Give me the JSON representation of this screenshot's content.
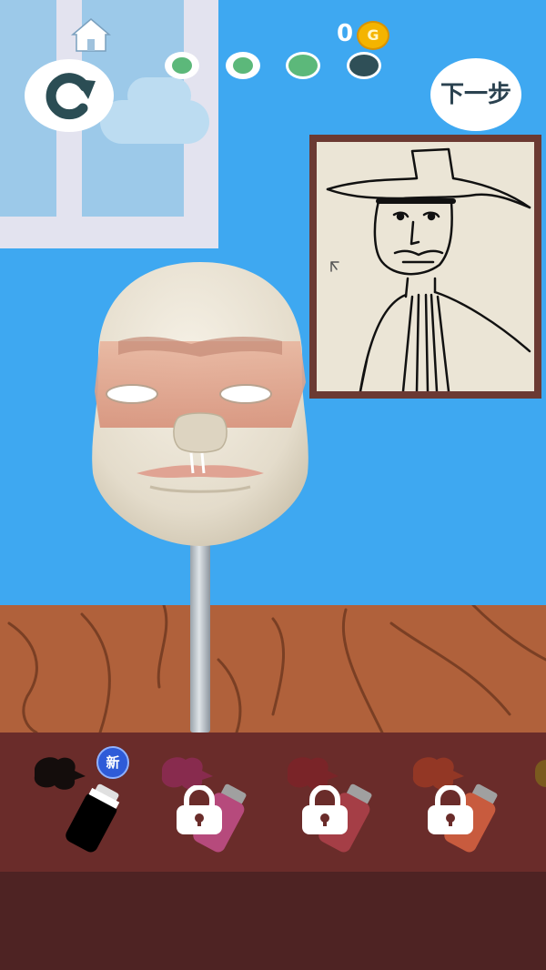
{
  "hud": {
    "coins": "0",
    "coin_symbol": "G",
    "next_label": "下一步",
    "progress": [
      "done",
      "done",
      "done",
      "current"
    ]
  },
  "colors": {
    "wall": "#3ea8f1",
    "floor": "#b0613b",
    "tray": "#6a2c2a",
    "progress_done": "#5cb87a",
    "progress_current": "#2f4f57",
    "accent": "#2b4250"
  },
  "tray": {
    "new_badge": "新",
    "paints": [
      {
        "color": "#000000",
        "locked": false,
        "name": "black"
      },
      {
        "color": "#b64a7c",
        "locked": true,
        "name": "magenta"
      },
      {
        "color": "#a53e46",
        "locked": true,
        "name": "red"
      },
      {
        "color": "#c85b3e",
        "locked": true,
        "name": "orange-red"
      }
    ]
  }
}
